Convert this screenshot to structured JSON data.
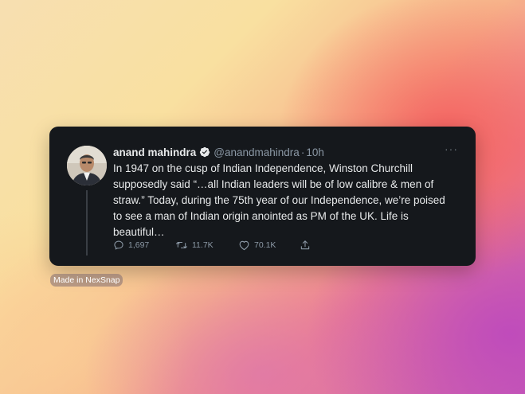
{
  "tweet": {
    "author_name": "anand mahindra",
    "handle": "@anandmahindra",
    "separator": "·",
    "time": "10h",
    "more": "···",
    "text": "In 1947 on the cusp of Indian Independence, Winston Churchill supposedly said “…all Indian leaders will be of low calibre & men of straw.” Today, during the 75th year of our Independence, we’re poised to see a man of Indian origin anointed as PM of the UK. Life is beautiful…",
    "replies": "1,697",
    "retweets": "11.7K",
    "likes": "70.1K"
  },
  "watermark": "Made in NexSnap",
  "colors": {
    "card_bg": "#15181c",
    "text": "#e7e9ea",
    "muted": "#8b98a5"
  },
  "icons": [
    "verified-badge-icon",
    "more-icon",
    "reply-icon",
    "retweet-icon",
    "like-icon",
    "share-icon"
  ]
}
